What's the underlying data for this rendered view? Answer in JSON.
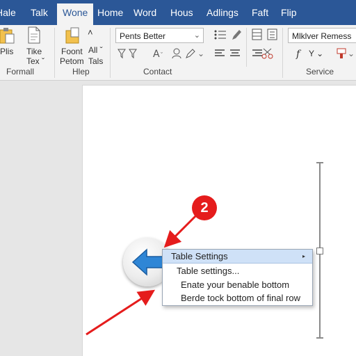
{
  "tabs": [
    {
      "label": "Hale",
      "active": false
    },
    {
      "label": "Talk",
      "active": false
    },
    {
      "label": "Wone",
      "active": true
    },
    {
      "label": "Home",
      "active": false
    },
    {
      "label": "Word",
      "active": false
    },
    {
      "label": "Hous",
      "active": false
    },
    {
      "label": "Adlings",
      "active": false
    },
    {
      "label": "Faft",
      "active": false
    },
    {
      "label": "Flip",
      "active": false
    }
  ],
  "ribbon": {
    "formall": {
      "plis_label": "Plis",
      "tike_label_line1": "Tike",
      "tike_label_line2": "Tex ˇ",
      "group_label": "Formall"
    },
    "hlep": {
      "font_label_line1": "Foont",
      "font_label_line2": "Petom",
      "all_label": "All ˇ",
      "tals_label": "Tals",
      "group_label": "Hlep"
    },
    "contact": {
      "font_box_value": "Pents Better",
      "group_label": "Contact"
    },
    "service": {
      "name_box_value": "Mlklver Remess",
      "group_label": "Service"
    }
  },
  "context_menu": {
    "items": [
      {
        "label": "Table Settings",
        "highlighted": true,
        "has_submenu": true
      },
      {
        "label": "Table settings...",
        "highlighted": false
      },
      {
        "label": "Enate your benable bottom",
        "highlighted": false
      },
      {
        "label": "Berde tock bottom of final row",
        "highlighted": false
      }
    ]
  },
  "annotation": {
    "step_number": "2",
    "color": "#e51c1c"
  },
  "colors": {
    "tabbar": "#2b5797",
    "ribbon": "#f3f3f3",
    "menu_highlight": "#cfe1f7",
    "arrow_blue": "#2f86d6"
  }
}
